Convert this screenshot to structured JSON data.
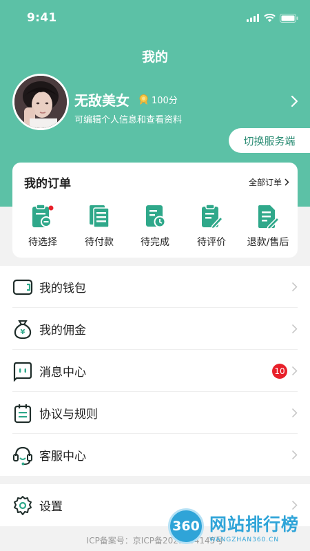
{
  "status_bar": {
    "time": "9:41"
  },
  "header": {
    "title": "我的"
  },
  "profile": {
    "name": "无敌美女",
    "points": "100分",
    "subtitle": "可编辑个人信息和查看资料",
    "switch_label": "切换服务端"
  },
  "orders": {
    "title": "我的订单",
    "all_label": "全部订单",
    "items": [
      {
        "label": "待选择",
        "icon": "pending-select-icon"
      },
      {
        "label": "待付款",
        "icon": "pending-payment-icon"
      },
      {
        "label": "待完成",
        "icon": "pending-complete-icon"
      },
      {
        "label": "待评价",
        "icon": "pending-review-icon"
      },
      {
        "label": "退款/售后",
        "icon": "refund-icon"
      }
    ]
  },
  "menu": {
    "items": [
      {
        "label": "我的钱包",
        "icon": "wallet-icon"
      },
      {
        "label": "我的佣金",
        "icon": "money-bag-icon"
      },
      {
        "label": "消息中心",
        "icon": "message-icon",
        "badge": "10"
      },
      {
        "label": "协议与规则",
        "icon": "calendar-doc-icon"
      },
      {
        "label": "客服中心",
        "icon": "headset-icon"
      }
    ],
    "settings": {
      "label": "设置",
      "icon": "gear-icon"
    }
  },
  "footer": {
    "icp": "ICP备案号：京ICP备2021004145号"
  },
  "watermark": {
    "badge": "360",
    "text": "网站排行榜",
    "sub": "WANGZHAN360.CN"
  },
  "colors": {
    "accent": "#5cc1a6",
    "icon_green": "#2fa88a",
    "badge_red": "#e8202a"
  }
}
